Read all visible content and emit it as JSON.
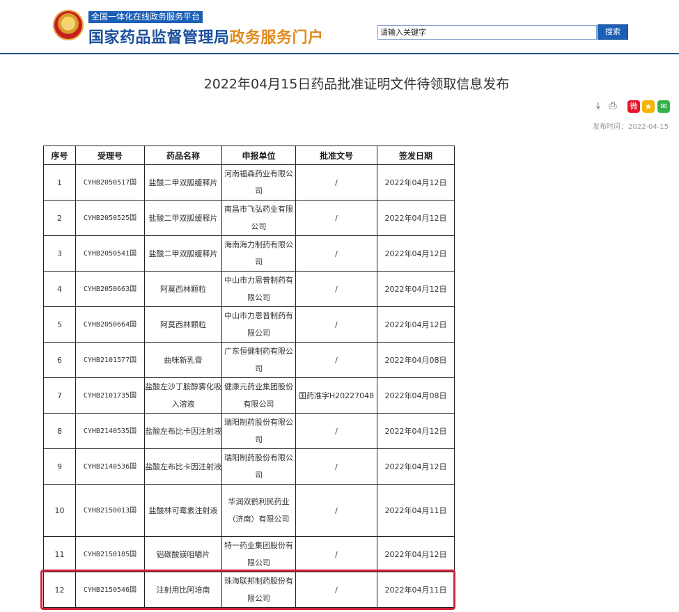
{
  "header": {
    "portal_tag": "全国一体化在线政务服务平台",
    "title_part1": "国家药品监督管理局",
    "title_part2": "政务服务门户",
    "search_placeholder": "请输入关键字",
    "search_button": "搜索"
  },
  "article": {
    "title": "2022年04月15日药品批准证明文件待领取信息发布",
    "publish_label": "发布时间：",
    "publish_date": "2022-04-15"
  },
  "tools": {
    "download": "⤓",
    "print": "⎙",
    "weibo": "微",
    "qzone": "★",
    "wechat": "✉"
  },
  "table": {
    "headers": [
      "序号",
      "受理号",
      "药品名称",
      "申报单位",
      "批准文号",
      "签发日期"
    ],
    "rows": [
      [
        "1",
        "CYHB2050517国",
        "盐酸二甲双胍缓释片",
        "河南福森药业有限公司",
        "/",
        "2022年04月12日"
      ],
      [
        "2",
        "CYHB2050525国",
        "盐酸二甲双胍缓释片",
        "南昌市飞弘药业有限公司",
        "/",
        "2022年04月12日"
      ],
      [
        "3",
        "CYHB2050541国",
        "盐酸二甲双胍缓释片",
        "海南海力制药有限公司",
        "/",
        "2022年04月12日"
      ],
      [
        "4",
        "CYHB2050663国",
        "阿莫西林颗粒",
        "中山市力恩普制药有限公司",
        "/",
        "2022年04月12日"
      ],
      [
        "5",
        "CYHB2050664国",
        "阿莫西林颗粒",
        "中山市力恩普制药有限公司",
        "/",
        "2022年04月12日"
      ],
      [
        "6",
        "CYHB2101577国",
        "曲咪新乳膏",
        "广东恒健制药有限公司",
        "/",
        "2022年04月08日"
      ],
      [
        "7",
        "CYHB2101735国",
        "盐酸左沙丁胺醇雾化吸入溶液",
        "健康元药业集团股份有限公司",
        "国药准字H20227048",
        "2022年04月08日"
      ],
      [
        "8",
        "CYHB2140535国",
        "盐酸左布比卡因注射液",
        "瑞阳制药股份有限公司",
        "/",
        "2022年04月12日"
      ],
      [
        "9",
        "CYHB2140536国",
        "盐酸左布比卡因注射液",
        "瑞阳制药股份有限公司",
        "/",
        "2022年04月12日"
      ],
      [
        "10",
        "CYHB2150013国",
        "盐酸林可霉素注射液",
        "华润双鹤利民药业（济南）有限公司",
        "/",
        "2022年04月11日"
      ],
      [
        "11",
        "CYHB2150185国",
        "铝碳酸镁咀嚼片",
        "特一药业集团股份有限公司",
        "/",
        "2022年04月12日"
      ],
      [
        "12",
        "CYHB2150546国",
        "注射用比阿培南",
        "珠海联邦制药股份有限公司",
        "/",
        "2022年04月11日"
      ]
    ],
    "row_heights": [
      51,
      51,
      51,
      51,
      51,
      51,
      51,
      51,
      51,
      75,
      51,
      51
    ]
  },
  "colors": {
    "brand_blue": "#1a4f9c",
    "brand_orange": "#e08a1e",
    "highlight_red": "#d0243a"
  }
}
